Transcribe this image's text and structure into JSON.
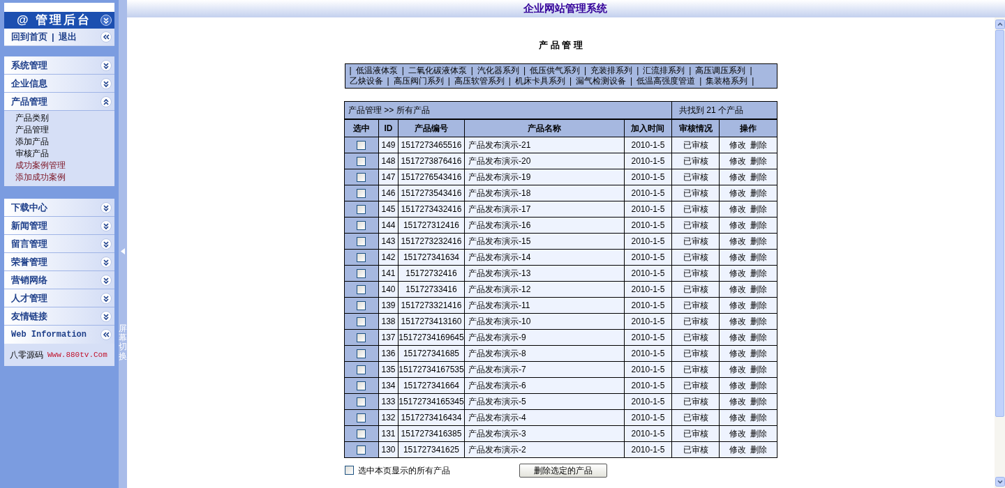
{
  "header": {
    "title": "企业网站管理系统"
  },
  "sidebar": {
    "title": "@ 管理后台",
    "links": [
      "回到首页",
      "退出"
    ],
    "link_separator": "|",
    "menus": [
      {
        "label": "系统管理",
        "expanded": false
      },
      {
        "label": "企业信息",
        "expanded": false
      },
      {
        "label": "产品管理",
        "expanded": true,
        "children": [
          {
            "label": "产品类别",
            "visited": false
          },
          {
            "label": "产品管理",
            "visited": false
          },
          {
            "label": "添加产品",
            "visited": false
          },
          {
            "label": "审核产品",
            "visited": false
          },
          {
            "label": "成功案例管理",
            "visited": true
          },
          {
            "label": "添加成功案例",
            "visited": true
          }
        ]
      }
    ],
    "menus_2": [
      {
        "label": "下载中心",
        "expanded": false
      },
      {
        "label": "新闻管理",
        "expanded": false
      },
      {
        "label": "留言管理",
        "expanded": false
      },
      {
        "label": "荣誉管理",
        "expanded": false
      },
      {
        "label": "营销网络",
        "expanded": false
      },
      {
        "label": "人才管理",
        "expanded": false
      },
      {
        "label": "友情链接",
        "expanded": false
      }
    ],
    "web_info": {
      "title": "Web Information",
      "text": "八零源码",
      "link": "Www.880tv.Com"
    }
  },
  "toggle_strip": {
    "label": "屏幕切换"
  },
  "page_title": "产 品 管 理",
  "category_bar": {
    "separator": "|",
    "lines": [
      [
        "低温液体泵",
        "二氧化碳液体泵",
        "汽化器系列",
        "低压供气系列",
        "充装排系列",
        "汇流排系列",
        "高压调压系列"
      ],
      [
        "乙炔设备",
        "高压阀门系列",
        "高压软管系列",
        "机床卡具系列",
        "漏气检测设备",
        "低温高强度管道",
        "集装格系列"
      ]
    ]
  },
  "table": {
    "breadcrumb": "产品管理 >> 所有产品",
    "count": "共找到 21 个产品",
    "columns": [
      "选中",
      "ID",
      "产品编号",
      "产品名称",
      "加入时间",
      "审核情况",
      "操作"
    ],
    "rows": [
      {
        "selected": false,
        "id": "149",
        "code": "1517273465516",
        "name": "产品发布演示-21",
        "date": "2010-1-5",
        "status": "已审核",
        "actions": [
          "修改",
          "删除"
        ]
      },
      {
        "selected": false,
        "id": "148",
        "code": "1517273876416",
        "name": "产品发布演示-20",
        "date": "2010-1-5",
        "status": "已审核",
        "actions": [
          "修改",
          "删除"
        ]
      },
      {
        "selected": false,
        "id": "147",
        "code": "1517276543416",
        "name": "产品发布演示-19",
        "date": "2010-1-5",
        "status": "已审核",
        "actions": [
          "修改",
          "删除"
        ]
      },
      {
        "selected": false,
        "id": "146",
        "code": "1517273543416",
        "name": "产品发布演示-18",
        "date": "2010-1-5",
        "status": "已审核",
        "actions": [
          "修改",
          "删除"
        ]
      },
      {
        "selected": false,
        "id": "145",
        "code": "1517273432416",
        "name": "产品发布演示-17",
        "date": "2010-1-5",
        "status": "已审核",
        "actions": [
          "修改",
          "删除"
        ]
      },
      {
        "selected": false,
        "id": "144",
        "code": "151727312416",
        "name": "产品发布演示-16",
        "date": "2010-1-5",
        "status": "已审核",
        "actions": [
          "修改",
          "删除"
        ]
      },
      {
        "selected": false,
        "id": "143",
        "code": "1517273232416",
        "name": "产品发布演示-15",
        "date": "2010-1-5",
        "status": "已审核",
        "actions": [
          "修改",
          "删除"
        ]
      },
      {
        "selected": false,
        "id": "142",
        "code": "151727341634",
        "name": "产品发布演示-14",
        "date": "2010-1-5",
        "status": "已审核",
        "actions": [
          "修改",
          "删除"
        ]
      },
      {
        "selected": false,
        "id": "141",
        "code": "15172732416",
        "name": "产品发布演示-13",
        "date": "2010-1-5",
        "status": "已审核",
        "actions": [
          "修改",
          "删除"
        ]
      },
      {
        "selected": false,
        "id": "140",
        "code": "15172733416",
        "name": "产品发布演示-12",
        "date": "2010-1-5",
        "status": "已审核",
        "actions": [
          "修改",
          "删除"
        ]
      },
      {
        "selected": false,
        "id": "139",
        "code": "1517273321416",
        "name": "产品发布演示-11",
        "date": "2010-1-5",
        "status": "已审核",
        "actions": [
          "修改",
          "删除"
        ]
      },
      {
        "selected": false,
        "id": "138",
        "code": "1517273413160",
        "name": "产品发布演示-10",
        "date": "2010-1-5",
        "status": "已审核",
        "actions": [
          "修改",
          "删除"
        ]
      },
      {
        "selected": false,
        "id": "137",
        "code": "15172734169645",
        "name": "产品发布演示-9",
        "date": "2010-1-5",
        "status": "已审核",
        "actions": [
          "修改",
          "删除"
        ]
      },
      {
        "selected": false,
        "id": "136",
        "code": "151727341685",
        "name": "产品发布演示-8",
        "date": "2010-1-5",
        "status": "已审核",
        "actions": [
          "修改",
          "删除"
        ]
      },
      {
        "selected": false,
        "id": "135",
        "code": "15172734167535",
        "name": "产品发布演示-7",
        "date": "2010-1-5",
        "status": "已审核",
        "actions": [
          "修改",
          "删除"
        ]
      },
      {
        "selected": false,
        "id": "134",
        "code": "151727341664",
        "name": "产品发布演示-6",
        "date": "2010-1-5",
        "status": "已审核",
        "actions": [
          "修改",
          "删除"
        ]
      },
      {
        "selected": false,
        "id": "133",
        "code": "15172734165345",
        "name": "产品发布演示-5",
        "date": "2010-1-5",
        "status": "已审核",
        "actions": [
          "修改",
          "删除"
        ]
      },
      {
        "selected": false,
        "id": "132",
        "code": "1517273416434",
        "name": "产品发布演示-4",
        "date": "2010-1-5",
        "status": "已审核",
        "actions": [
          "修改",
          "删除"
        ]
      },
      {
        "selected": false,
        "id": "131",
        "code": "1517273416385",
        "name": "产品发布演示-3",
        "date": "2010-1-5",
        "status": "已审核",
        "actions": [
          "修改",
          "删除"
        ]
      },
      {
        "selected": false,
        "id": "130",
        "code": "151727341625",
        "name": "产品发布演示-2",
        "date": "2010-1-5",
        "status": "已审核",
        "actions": [
          "修改",
          "删除"
        ]
      }
    ]
  },
  "footer": {
    "select_all": {
      "label": "选中本页显示的所有产品",
      "checked": false
    },
    "button": "删除选定的产品"
  }
}
